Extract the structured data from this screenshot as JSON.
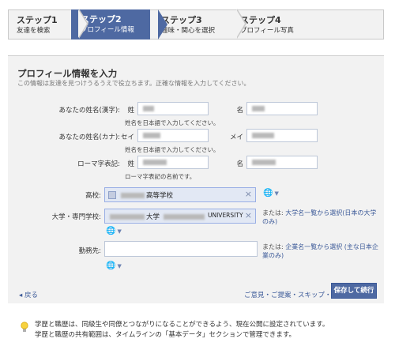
{
  "steps": [
    {
      "title": "ステップ1",
      "sub": "友達を検索"
    },
    {
      "title": "ステップ2",
      "sub": "プロフィール情報"
    },
    {
      "title": "ステップ3",
      "sub": "趣味・関心を選択"
    },
    {
      "title": "ステップ4",
      "sub": "プロフィール写真"
    }
  ],
  "panel": {
    "title": "プロフィール情報を入力",
    "desc": "この情報は友達を見つけうるうえで役立ちます。正確な情報を入力してください。"
  },
  "name_kanji": {
    "label": "あなたの姓名(漢字):",
    "last": "姓",
    "first": "名",
    "hint": "姓名を日本語で入力してください。"
  },
  "name_kana": {
    "label": "あなたの姓名(カナ):",
    "last": "セイ",
    "first": "メイ",
    "hint": "姓名を日本語で入力してください。"
  },
  "name_roman": {
    "label": "ローマ字表記:",
    "last": "姓",
    "first": "名",
    "hint": "ローマ字表記の名前です。"
  },
  "highschool": {
    "label": "高校:",
    "value_suffix": "高等学校",
    "remove": "×"
  },
  "university": {
    "label": "大学・専門学校:",
    "value_mid": "大学",
    "value_suffix": "UNIVERSITY",
    "remove": "×",
    "side_prefix": "または: ",
    "side_link": "大学名一覧から選択(日本の大学のみ)"
  },
  "employer": {
    "label": "勤務先:",
    "value": "",
    "side_prefix": "または: ",
    "side_link": "企業名一覧から選択 (主な日本企業のみ)"
  },
  "footer": {
    "back": "◂ 戻る",
    "skip": "ご意見・ご提案・スキップ・",
    "save": "保存して続行"
  },
  "tip": {
    "line1": "学歴と職歴は、同級生や同僚とつながりになることができるよう、現在公開に設定されています。",
    "line2": "学歴と職歴の共有範囲は、タイムラインの「基本データ」セクションで管理できます。"
  },
  "icons": {
    "globe": "globe-icon",
    "chevron": "chevron-down-icon",
    "bulb": "lightbulb-icon"
  }
}
